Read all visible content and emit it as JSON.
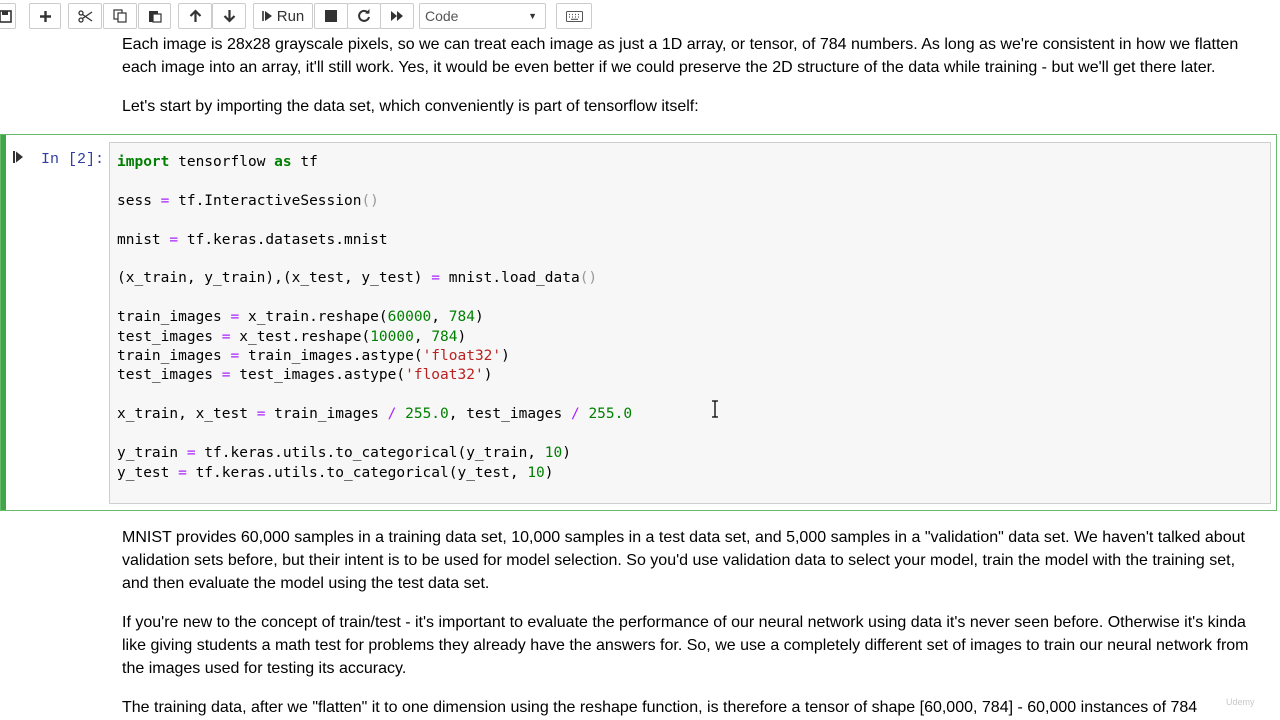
{
  "toolbar": {
    "run_label": "Run",
    "cell_type": "Code",
    "buttons": [
      "save-icon",
      "add-icon",
      "cut-icon",
      "copy-icon",
      "paste-icon",
      "move-up-icon",
      "move-down-icon",
      "run-icon",
      "stop-icon",
      "restart-icon",
      "fast-forward-icon",
      "keyboard-icon"
    ]
  },
  "markdown_top": {
    "p1": "Each image is 28x28 grayscale pixels, so we can treat each image as just a 1D array, or tensor, of 784 numbers. As long as we're consistent in how we flatten each image into an array, it'll still work. Yes, it would be even better if we could preserve the 2D structure of the data while training - but we'll get there later.",
    "p2": "Let's start by importing the data set, which conveniently is part of tensorflow itself:"
  },
  "code_cell": {
    "prompt": "In [2]:",
    "lines": [
      "import tensorflow as tf",
      "",
      "sess = tf.InteractiveSession()",
      "",
      "mnist = tf.keras.datasets.mnist",
      "",
      "(x_train, y_train),(x_test, y_test) = mnist.load_data()",
      "",
      "train_images = x_train.reshape(60000, 784)",
      "test_images = x_test.reshape(10000, 784)",
      "train_images = train_images.astype('float32')",
      "test_images = test_images.astype('float32')",
      "",
      "x_train, x_test = train_images / 255.0, test_images / 255.0",
      "",
      "y_train = tf.keras.utils.to_categorical(y_train, 10)",
      "y_test = tf.keras.utils.to_categorical(y_test, 10)"
    ]
  },
  "markdown_bottom": {
    "p1": "MNIST provides 60,000 samples in a training data set, 10,000 samples in a test data set, and 5,000 samples in a \"validation\" data set. We haven't talked about validation sets before, but their intent is to be used for model selection. So you'd use validation data to select your model, train the model with the training set, and then evaluate the model using the test data set.",
    "p2": "If you're new to the concept of train/test - it's important to evaluate the performance of our neural network using data it's never seen before. Otherwise it's kinda like giving students a math test for problems they already have the answers for. So, we use a completely different set of images to train our neural network from the images used for testing its accuracy.",
    "p3": "The training data, after we \"flatten\" it to one dimension using the reshape function, is therefore a tensor of shape [60,000, 784] - 60,000 instances of 784"
  },
  "watermark": "Udemy"
}
